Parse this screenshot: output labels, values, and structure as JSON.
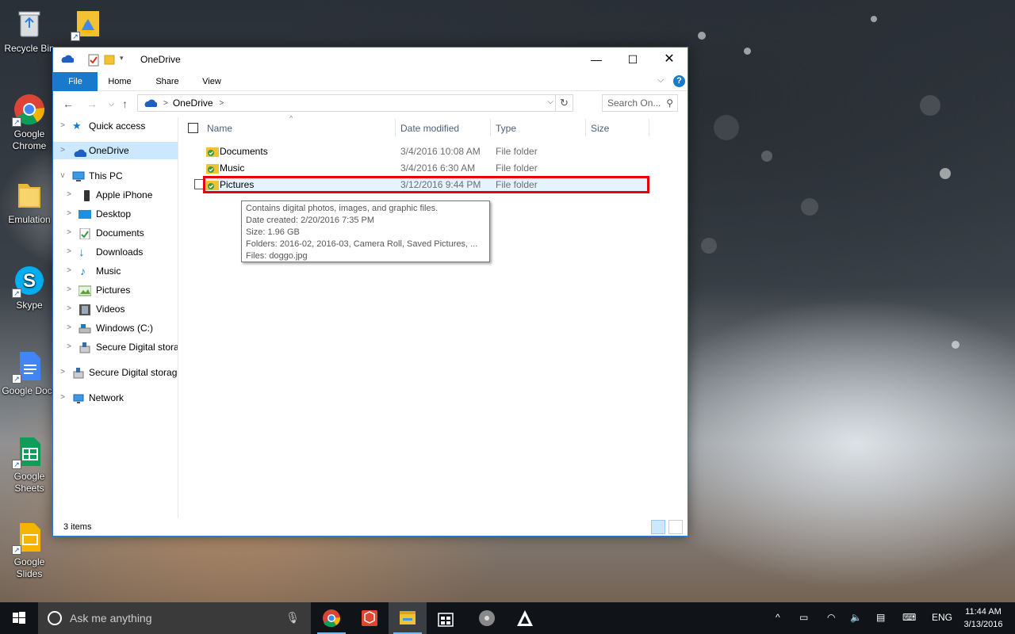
{
  "desktop": {
    "icons": [
      {
        "label": "Recycle Bin"
      },
      {
        "label": "Google Chrome"
      },
      {
        "label": "Emulation"
      },
      {
        "label": "Skype"
      },
      {
        "label": "Google Docs"
      },
      {
        "label": "Google Sheets"
      },
      {
        "label": "Google Slides"
      }
    ]
  },
  "window": {
    "title": "OneDrive",
    "ribbon_tabs": [
      "File",
      "Home",
      "Share",
      "View"
    ],
    "address": {
      "root": "OneDrive",
      "separator": ">"
    },
    "search_placeholder": "Search On...",
    "nav": {
      "quick_access": "Quick access",
      "onedrive": "OneDrive",
      "this_pc": "This PC",
      "pc_items": [
        {
          "label": "Apple iPhone",
          "icon": "phone-icon"
        },
        {
          "label": "Desktop",
          "icon": "desktop-icon"
        },
        {
          "label": "Documents",
          "icon": "documents-icon"
        },
        {
          "label": "Downloads",
          "icon": "downloads-icon"
        },
        {
          "label": "Music",
          "icon": "music-icon"
        },
        {
          "label": "Pictures",
          "icon": "pictures-icon"
        },
        {
          "label": "Videos",
          "icon": "videos-icon"
        },
        {
          "label": "Windows (C:)",
          "icon": "drive-icon"
        },
        {
          "label": "Secure Digital storag",
          "icon": "sd-card-icon"
        }
      ],
      "sd_storage": "Secure Digital storage",
      "network": "Network"
    },
    "columns": {
      "name": "Name",
      "date": "Date modified",
      "type": "Type",
      "size": "Size"
    },
    "files": [
      {
        "name": "Documents",
        "date": "3/4/2016 10:08 AM",
        "type": "File folder",
        "size": ""
      },
      {
        "name": "Music",
        "date": "3/4/2016 6:30 AM",
        "type": "File folder",
        "size": ""
      },
      {
        "name": "Pictures",
        "date": "3/12/2016 9:44 PM",
        "type": "File folder",
        "size": ""
      }
    ],
    "tooltip": {
      "line1": "Contains digital photos, images, and graphic files.",
      "line2": "Date created: 2/20/2016 7:35 PM",
      "line3": "Size: 1.96 GB",
      "line4": "Folders: 2016-02, 2016-03, Camera Roll, Saved Pictures, ...",
      "line5": "Files: doggo.jpg"
    },
    "status": "3 items"
  },
  "taskbar": {
    "search_placeholder": "Ask me anything",
    "language": "ENG",
    "time": "11:44 AM",
    "date": "3/13/2016"
  },
  "colors": {
    "accent": "#1979ca",
    "selection": "#cce8ff",
    "highlight_box": "#e8000b",
    "taskbar": "#101418"
  }
}
